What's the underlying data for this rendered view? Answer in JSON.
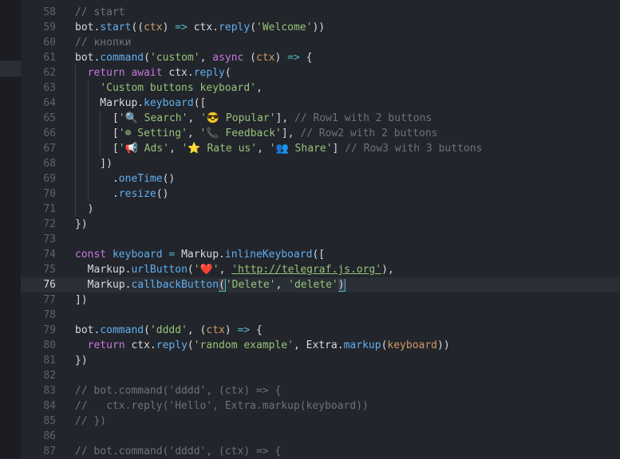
{
  "editor": {
    "current_line": 76,
    "lines": [
      {
        "n": 58,
        "tokens": [
          {
            "c": "cm",
            "t": "// start"
          }
        ]
      },
      {
        "n": 59,
        "tokens": [
          {
            "c": "pl",
            "t": "bot."
          },
          {
            "c": "fn",
            "t": "start"
          },
          {
            "c": "pl",
            "t": "(("
          },
          {
            "c": "pr",
            "t": "ctx"
          },
          {
            "c": "pl",
            "t": ") "
          },
          {
            "c": "op",
            "t": "=>"
          },
          {
            "c": "pl",
            "t": " ctx."
          },
          {
            "c": "fn",
            "t": "reply"
          },
          {
            "c": "pl",
            "t": "("
          },
          {
            "c": "st",
            "t": "'Welcome'"
          },
          {
            "c": "pl",
            "t": "))"
          }
        ]
      },
      {
        "n": 60,
        "tokens": [
          {
            "c": "cm",
            "t": "// кнопки"
          }
        ]
      },
      {
        "n": 61,
        "tokens": [
          {
            "c": "pl",
            "t": "bot."
          },
          {
            "c": "fn",
            "t": "command"
          },
          {
            "c": "pl",
            "t": "("
          },
          {
            "c": "st",
            "t": "'custom'"
          },
          {
            "c": "pl",
            "t": ", "
          },
          {
            "c": "kw",
            "t": "async"
          },
          {
            "c": "pl",
            "t": " ("
          },
          {
            "c": "pr",
            "t": "ctx"
          },
          {
            "c": "pl",
            "t": ") "
          },
          {
            "c": "op",
            "t": "=>"
          },
          {
            "c": "pl",
            "t": " {"
          }
        ]
      },
      {
        "n": 62,
        "tokens": [
          {
            "c": "pl",
            "t": "  "
          },
          {
            "c": "kw",
            "t": "return await"
          },
          {
            "c": "pl",
            "t": " ctx."
          },
          {
            "c": "fn",
            "t": "reply"
          },
          {
            "c": "pl",
            "t": "("
          }
        ]
      },
      {
        "n": 63,
        "tokens": [
          {
            "c": "pl",
            "t": "    "
          },
          {
            "c": "st",
            "t": "'Custom buttons keyboard'"
          },
          {
            "c": "pl",
            "t": ","
          }
        ]
      },
      {
        "n": 64,
        "tokens": [
          {
            "c": "pl",
            "t": "    Markup."
          },
          {
            "c": "fn",
            "t": "keyboard"
          },
          {
            "c": "pl",
            "t": "(["
          }
        ]
      },
      {
        "n": 65,
        "tokens": [
          {
            "c": "pl",
            "t": "      ["
          },
          {
            "c": "st",
            "t": "'🔍 Search'"
          },
          {
            "c": "pl",
            "t": ", "
          },
          {
            "c": "st",
            "t": "'😎 Popular'"
          },
          {
            "c": "pl",
            "t": "], "
          },
          {
            "c": "cm",
            "t": "// Row1 with 2 buttons"
          }
        ]
      },
      {
        "n": 66,
        "tokens": [
          {
            "c": "pl",
            "t": "      ["
          },
          {
            "c": "st",
            "t": "'☸ Setting'"
          },
          {
            "c": "pl",
            "t": ", "
          },
          {
            "c": "st",
            "t": "'📞 Feedback'"
          },
          {
            "c": "pl",
            "t": "], "
          },
          {
            "c": "cm",
            "t": "// Row2 with 2 buttons"
          }
        ]
      },
      {
        "n": 67,
        "tokens": [
          {
            "c": "pl",
            "t": "      ["
          },
          {
            "c": "st",
            "t": "'📢 Ads'"
          },
          {
            "c": "pl",
            "t": ", "
          },
          {
            "c": "st",
            "t": "'⭐ Rate us'"
          },
          {
            "c": "pl",
            "t": ", "
          },
          {
            "c": "st",
            "t": "'👥 Share'"
          },
          {
            "c": "pl",
            "t": "] "
          },
          {
            "c": "cm",
            "t": "// Row3 with 3 buttons"
          }
        ]
      },
      {
        "n": 68,
        "tokens": [
          {
            "c": "pl",
            "t": "    ])"
          }
        ]
      },
      {
        "n": 69,
        "tokens": [
          {
            "c": "pl",
            "t": "      ."
          },
          {
            "c": "fn",
            "t": "oneTime"
          },
          {
            "c": "pl",
            "t": "()"
          }
        ]
      },
      {
        "n": 70,
        "tokens": [
          {
            "c": "pl",
            "t": "      ."
          },
          {
            "c": "fn",
            "t": "resize"
          },
          {
            "c": "pl",
            "t": "()"
          }
        ]
      },
      {
        "n": 71,
        "tokens": [
          {
            "c": "pl",
            "t": "  )"
          }
        ]
      },
      {
        "n": 72,
        "tokens": [
          {
            "c": "pl",
            "t": "})"
          }
        ]
      },
      {
        "n": 73,
        "tokens": []
      },
      {
        "n": 74,
        "tokens": [
          {
            "c": "kw",
            "t": "const"
          },
          {
            "c": "pl",
            "t": " "
          },
          {
            "c": "fn",
            "t": "keyboard"
          },
          {
            "c": "pl",
            "t": " "
          },
          {
            "c": "op",
            "t": "="
          },
          {
            "c": "pl",
            "t": " Markup."
          },
          {
            "c": "fn",
            "t": "inlineKeyboard"
          },
          {
            "c": "pl",
            "t": "(["
          }
        ]
      },
      {
        "n": 75,
        "tokens": [
          {
            "c": "pl",
            "t": "  Markup."
          },
          {
            "c": "fn",
            "t": "urlButton"
          },
          {
            "c": "pl",
            "t": "("
          },
          {
            "c": "st",
            "t": "'❤️'"
          },
          {
            "c": "pl",
            "t": ", "
          },
          {
            "c": "st ul",
            "t": "'http://telegraf.js.org'"
          },
          {
            "c": "pl",
            "t": "),"
          }
        ]
      },
      {
        "n": 76,
        "tokens": [
          {
            "c": "pl",
            "t": "  Markup."
          },
          {
            "c": "fn",
            "t": "callbackButton"
          },
          {
            "c": "pl br",
            "t": "("
          },
          {
            "c": "st",
            "t": "'Delete'"
          },
          {
            "c": "pl",
            "t": ", "
          },
          {
            "c": "st",
            "t": "'delete'"
          },
          {
            "c": "pl br",
            "t": ")"
          }
        ]
      },
      {
        "n": 77,
        "tokens": [
          {
            "c": "pl",
            "t": "])"
          }
        ]
      },
      {
        "n": 78,
        "tokens": []
      },
      {
        "n": 79,
        "tokens": [
          {
            "c": "pl",
            "t": "bot."
          },
          {
            "c": "fn",
            "t": "command"
          },
          {
            "c": "pl",
            "t": "("
          },
          {
            "c": "st",
            "t": "'dddd'"
          },
          {
            "c": "pl",
            "t": ", ("
          },
          {
            "c": "pr",
            "t": "ctx"
          },
          {
            "c": "pl",
            "t": ") "
          },
          {
            "c": "op",
            "t": "=>"
          },
          {
            "c": "pl",
            "t": " {"
          }
        ]
      },
      {
        "n": 80,
        "tokens": [
          {
            "c": "pl",
            "t": "  "
          },
          {
            "c": "kw",
            "t": "return"
          },
          {
            "c": "pl",
            "t": " ctx."
          },
          {
            "c": "fn",
            "t": "reply"
          },
          {
            "c": "pl",
            "t": "("
          },
          {
            "c": "st",
            "t": "'random example'"
          },
          {
            "c": "pl",
            "t": ", Extra."
          },
          {
            "c": "fn",
            "t": "markup"
          },
          {
            "c": "pl",
            "t": "("
          },
          {
            "c": "pr",
            "t": "keyboard"
          },
          {
            "c": "pl",
            "t": "))"
          }
        ]
      },
      {
        "n": 81,
        "tokens": [
          {
            "c": "pl",
            "t": "})"
          }
        ]
      },
      {
        "n": 82,
        "tokens": []
      },
      {
        "n": 83,
        "tokens": [
          {
            "c": "cm",
            "t": "// bot.command('dddd', (ctx) => {"
          }
        ]
      },
      {
        "n": 84,
        "tokens": [
          {
            "c": "cm",
            "t": "//   ctx.reply('Hello', Extra.markup(keyboard))"
          }
        ]
      },
      {
        "n": 85,
        "tokens": [
          {
            "c": "cm",
            "t": "// })"
          }
        ]
      },
      {
        "n": 86,
        "tokens": []
      },
      {
        "n": 87,
        "tokens": [
          {
            "c": "cm",
            "t": "// bot.command('dddd', (ctx) => {"
          }
        ]
      }
    ]
  }
}
